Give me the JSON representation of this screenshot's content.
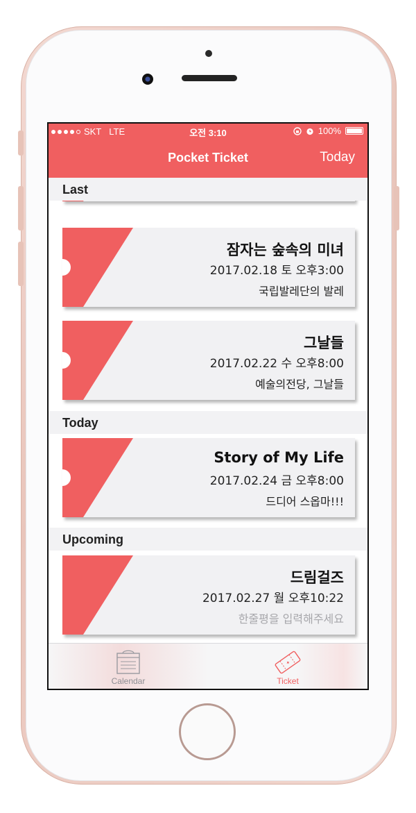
{
  "colors": {
    "accent": "#f05f60",
    "card": "#f1f1f3",
    "section": "#f2f2f4"
  },
  "statusbar": {
    "carrier": "SKT",
    "network": "LTE",
    "time": "오전 3:10",
    "battery": "100%"
  },
  "navbar": {
    "title": "Pocket Ticket",
    "today_label": "Today"
  },
  "sections": {
    "last": "Last",
    "today": "Today",
    "upcoming": "Upcoming"
  },
  "tickets": [
    {
      "title": "",
      "date": "",
      "note": ""
    },
    {
      "title": "잠자는 숲속의 미녀",
      "date": "2017.02.18 토 오후3:00",
      "note": "국립발레단의 발레"
    },
    {
      "title": "그날들",
      "date": "2017.02.22 수 오후8:00",
      "note": "예술의전당, 그날들"
    },
    {
      "title": "Story of My Life",
      "date": "2017.02.24 금 오후8:00",
      "note": "드디어 스옵마!!!"
    },
    {
      "title": "드림걸즈",
      "date": "2017.02.27 월 오후10:22",
      "note": "한줄평을 입력해주세요"
    }
  ],
  "tabbar": {
    "calendar_label": "Calendar",
    "ticket_label": "Ticket",
    "calendar_icon": "calendar-icon",
    "ticket_icon": "ticket-icon",
    "selected": "Ticket"
  }
}
